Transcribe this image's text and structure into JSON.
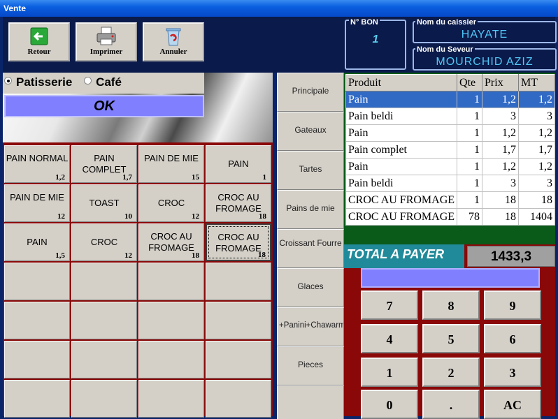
{
  "window": {
    "title": "Vente"
  },
  "toolbar": {
    "back_label": "Retour",
    "print_label": "Imprimer",
    "cancel_label": "Annuler"
  },
  "bon": {
    "caption": "N° BON",
    "value": "1"
  },
  "cashier": {
    "caption": "Nom du caissier",
    "value": "HAYATE"
  },
  "server": {
    "caption": "Nom du Seveur",
    "value": "MOURCHID AZIZ"
  },
  "mode": {
    "options": [
      "Patisserie",
      "Café"
    ],
    "selected": "Patisserie",
    "ok_label": "OK"
  },
  "products": [
    {
      "name": "PAIN NORMAL",
      "price": "1,2"
    },
    {
      "name": "PAIN COMPLET",
      "price": "1,7"
    },
    {
      "name": "PAIN DE MIE",
      "price": "15"
    },
    {
      "name": "PAIN",
      "price": "1"
    },
    {
      "name": "PAIN DE MIE",
      "price": "12"
    },
    {
      "name": "TOAST",
      "price": "10"
    },
    {
      "name": "CROC",
      "price": "12"
    },
    {
      "name": "CROC AU FROMAGE",
      "price": "18"
    },
    {
      "name": "PAIN",
      "price": "1,5"
    },
    {
      "name": "CROC",
      "price": "12"
    },
    {
      "name": "CROC AU FROMAGE",
      "price": "18"
    },
    {
      "name": "CROC AU FROMAGE",
      "price": "18"
    }
  ],
  "categories": [
    "Principale",
    "Gateaux",
    "Tartes",
    "Pains de mie",
    "Croissant Fourre",
    "Glaces",
    "+Panini+Chawarma",
    "Pieces",
    ""
  ],
  "order": {
    "headers": [
      "Produit",
      "Qte",
      "Prix",
      "MT"
    ],
    "rows": [
      [
        "Pain",
        "1",
        "1,2",
        "1,2"
      ],
      [
        "Pain beldi",
        "1",
        "3",
        "3"
      ],
      [
        "Pain",
        "1",
        "1,2",
        "1,2"
      ],
      [
        "Pain complet",
        "1",
        "1,7",
        "1,7"
      ],
      [
        "Pain",
        "1",
        "1,2",
        "1,2"
      ],
      [
        "Pain beldi",
        "1",
        "3",
        "3"
      ],
      [
        "CROC AU FROMAGE",
        "1",
        "18",
        "18"
      ],
      [
        "CROC AU FROMAGE",
        "78",
        "18",
        "1404"
      ]
    ]
  },
  "total": {
    "label": "TOTAL A PAYER",
    "value": "1433,3"
  },
  "keypad": {
    "keys": [
      "7",
      "8",
      "9",
      "4",
      "5",
      "6",
      "1",
      "2",
      "3",
      "0",
      ".",
      "AC"
    ]
  }
}
